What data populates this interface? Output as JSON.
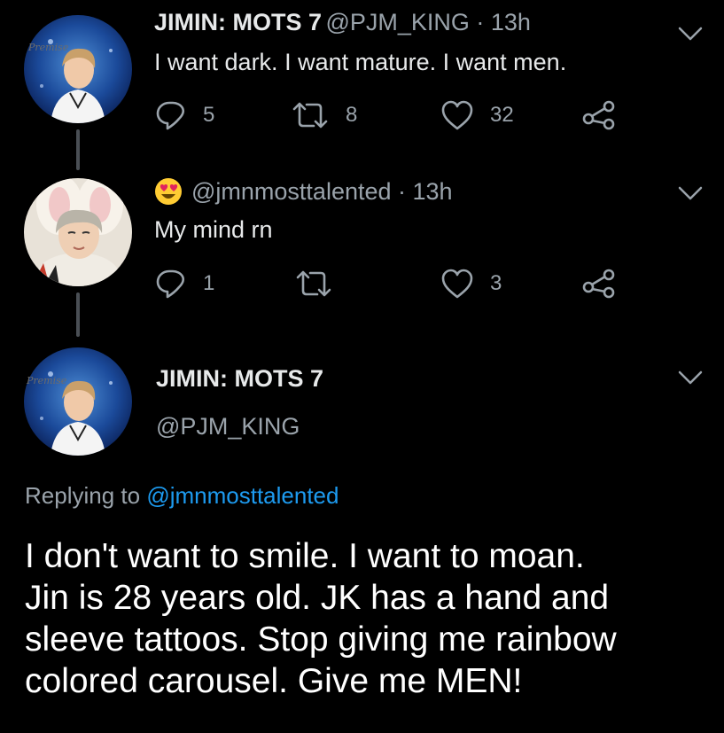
{
  "tweet1": {
    "name": "JIMIN: MOTS 7",
    "handle_time": "@PJM_KING · 13h",
    "text": "I want dark. I want mature. I want men.",
    "replies": "5",
    "retweets": "8",
    "likes": "32",
    "avatar_caption": "Premise"
  },
  "tweet2": {
    "emoji": "heart-eyes-emoji",
    "handle_time": "@jmnmosttalented · 13h",
    "text": "My mind rn",
    "replies": "1",
    "retweets": "",
    "likes": "3"
  },
  "tweet3": {
    "name": "JIMIN: MOTS 7",
    "handle": "@PJM_KING",
    "replying_prefix": "Replying to ",
    "replying_to": "@jmnmosttalented",
    "text_lines": [
      "I don't want to smile. I want to moan.",
      "Jin is 28 years old. JK has a hand and",
      "sleeve tattoos. Stop giving me rainbow",
      "colored carousel. Give me MEN!"
    ],
    "avatar_caption": "Premise"
  },
  "colors": {
    "background": "#000000",
    "text": "#e7e9ea",
    "secondary": "#9aa3ab",
    "link": "#1d9bf0"
  },
  "icons": [
    "reply-icon",
    "retweet-icon",
    "like-icon",
    "share-icon",
    "chevron-down-icon"
  ]
}
